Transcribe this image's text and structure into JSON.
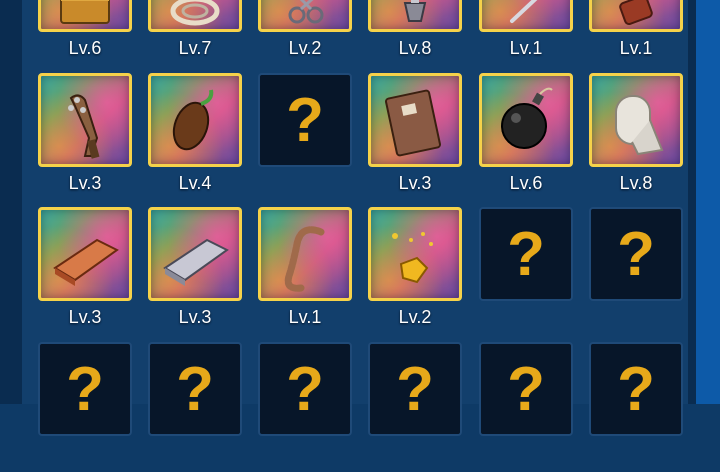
{
  "colors": {
    "background": "#123f6c",
    "tile_border": "#f5d24a",
    "question_mark": "#e7a91a",
    "locked_tile": "#071629"
  },
  "rows": [
    [
      {
        "icon": "treasure-chest-icon",
        "level": "Lv.6",
        "locked": false
      },
      {
        "icon": "rope-coil-icon",
        "level": "Lv.7",
        "locked": false
      },
      {
        "icon": "scissors-icon",
        "level": "Lv.2",
        "locked": false
      },
      {
        "icon": "drill-icon",
        "level": "Lv.8",
        "locked": false
      },
      {
        "icon": "needle-icon",
        "level": "Lv.1",
        "locked": false
      },
      {
        "icon": "battery-icon",
        "level": "Lv.1",
        "locked": false
      }
    ],
    [
      {
        "icon": "spiked-club-icon",
        "level": "Lv.3",
        "locked": false
      },
      {
        "icon": "seed-icon",
        "level": "Lv.4",
        "locked": false
      },
      {
        "icon": "question-mark-icon",
        "level": "",
        "locked": true,
        "symbol": "?"
      },
      {
        "icon": "book-icon",
        "level": "Lv.3",
        "locked": false
      },
      {
        "icon": "bomb-icon",
        "level": "Lv.6",
        "locked": false
      },
      {
        "icon": "paper-towel-icon",
        "level": "Lv.8",
        "locked": false
      }
    ],
    [
      {
        "icon": "copper-ingot-icon",
        "level": "Lv.3",
        "locked": false
      },
      {
        "icon": "iron-ingot-icon",
        "level": "Lv.3",
        "locked": false
      },
      {
        "icon": "earthworm-icon",
        "level": "Lv.1",
        "locked": false
      },
      {
        "icon": "gold-nugget-icon",
        "level": "Lv.2",
        "locked": false
      },
      {
        "icon": "question-mark-icon",
        "level": "",
        "locked": true,
        "symbol": "?"
      },
      {
        "icon": "question-mark-icon",
        "level": "",
        "locked": true,
        "symbol": "?"
      }
    ],
    [
      {
        "icon": "question-mark-icon",
        "level": "",
        "locked": true,
        "symbol": "?"
      },
      {
        "icon": "question-mark-icon",
        "level": "",
        "locked": true,
        "symbol": "?"
      },
      {
        "icon": "question-mark-icon",
        "level": "",
        "locked": true,
        "symbol": "?"
      },
      {
        "icon": "question-mark-icon",
        "level": "",
        "locked": true,
        "symbol": "?"
      },
      {
        "icon": "question-mark-icon",
        "level": "",
        "locked": true,
        "symbol": "?"
      },
      {
        "icon": "question-mark-icon",
        "level": "",
        "locked": true,
        "symbol": "?"
      }
    ]
  ]
}
